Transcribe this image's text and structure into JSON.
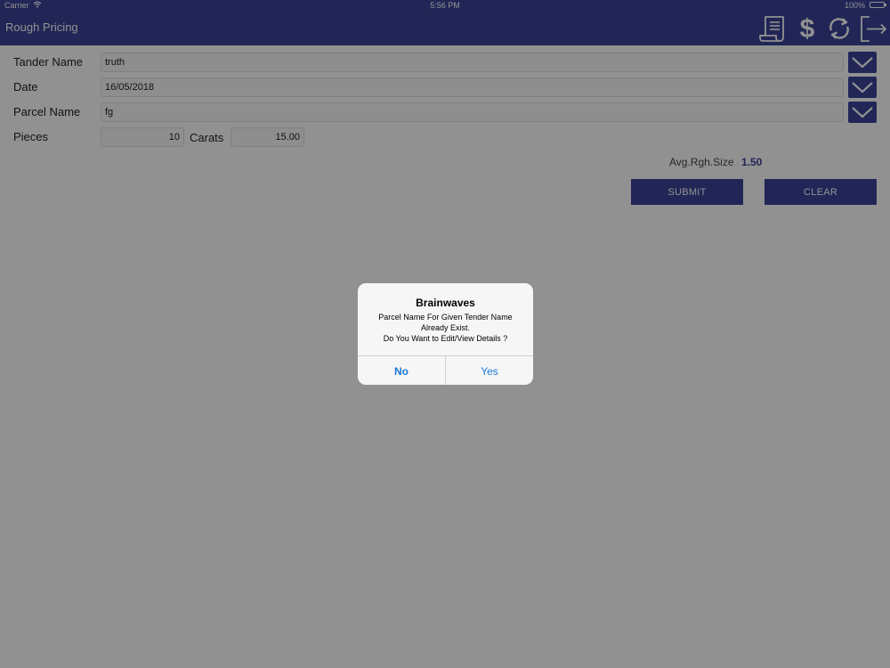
{
  "status_bar": {
    "carrier": "Carrier",
    "time": "5:56 PM",
    "battery": "100%",
    "battery_level": 1.0
  },
  "nav": {
    "title": "Rough Pricing",
    "icons": [
      "receipt-icon",
      "dollar-icon",
      "sync-icon",
      "logout-icon"
    ]
  },
  "form": {
    "tender_name": {
      "label": "Tander Name",
      "value": "truth"
    },
    "date": {
      "label": "Date",
      "value": "16/05/2018"
    },
    "parcel_name": {
      "label": "Parcel Name",
      "value": "fg"
    },
    "pieces": {
      "label": "Pieces",
      "value": "10"
    },
    "carats": {
      "label": "Carats",
      "value": "15.00"
    },
    "avg_rgh_size": {
      "label": "Avg.Rgh.Size",
      "value": "1.50"
    }
  },
  "buttons": {
    "submit": "SUBMIT",
    "clear": "CLEAR"
  },
  "alert": {
    "title": "Brainwaves",
    "message_lines": [
      "Parcel Name For Given Tender Name",
      "Already Exist.",
      "Do You Want to Edit/View Details ?"
    ],
    "no": "No",
    "yes": "Yes"
  },
  "colors": {
    "primary": "#3a4399",
    "overlay": "rgba(0,0,0,0.43)",
    "alert_action": "#1a78d8"
  }
}
